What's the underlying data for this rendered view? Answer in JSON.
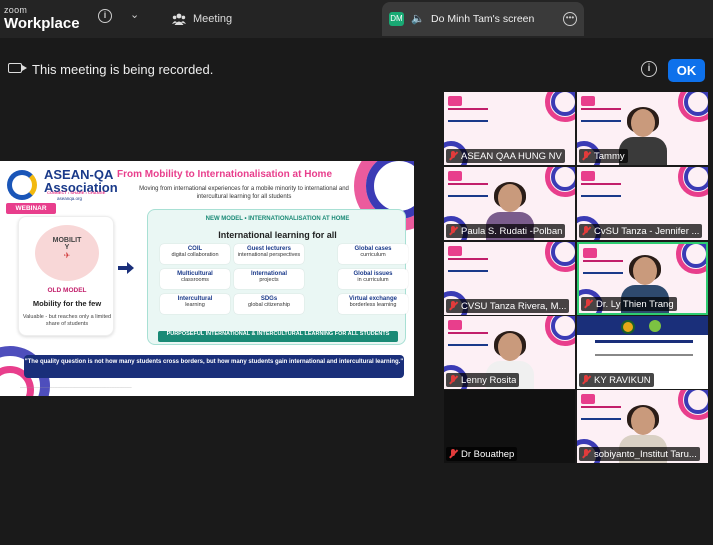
{
  "app": {
    "brand_top": "zoom",
    "brand_bottom": "Workplace"
  },
  "topbar": {
    "meeting_label": "Meeting",
    "share_badge": "DM",
    "share_label": "Do Minh Tam's screen"
  },
  "recording": {
    "message": "This meeting is being recorded.",
    "ok_label": "OK"
  },
  "slide": {
    "logo_title": "ASEAN-QA\nAssociation",
    "logo_tag": "CONNECT • SHARE • CHANGE",
    "logo_url": "aseanqa.org",
    "webinar_label": "WEBINAR",
    "title": "From Mobility to Internationalisation at Home",
    "subtitle": "Moving from international experiences for a mobile minority to international and intercultural learning for all students",
    "old_model": {
      "circle_line1": "MOBILIT",
      "circle_line2": "Y",
      "label": "OLD MODEL",
      "title": "Mobility for the few",
      "description": "Valuable - but reaches only a limited share of students"
    },
    "new_model": {
      "label": "NEW MODEL  •  INTERNATIONALISATION AT HOME",
      "title": "International learning for all",
      "cells": [
        {
          "heading": "COIL",
          "detail": "digital collaboration"
        },
        {
          "heading": "Guest lecturers",
          "detail": "international perspectives"
        },
        {
          "heading": "Global cases",
          "detail": "curriculum"
        },
        {
          "heading": "Multicultural",
          "detail": "classrooms"
        },
        {
          "heading": "International",
          "detail": "projects"
        },
        {
          "heading": "Global issues",
          "detail": "in curriculum"
        },
        {
          "heading": "Intercultural",
          "detail": "learning"
        },
        {
          "heading": "SDGs",
          "detail": "global citizenship"
        },
        {
          "heading": "Virtual exchange",
          "detail": "borderless learning"
        }
      ],
      "footer": "PURPOSEFUL INTERNATIONAL & INTERCULTURAL LEARNING FOR ALL STUDENTS"
    },
    "quote": "\"The quality question is not how many students cross borders, but how many students gain international and intercultural learning.\""
  },
  "participants": [
    {
      "name": "ASEAN QAA HUNG NV",
      "kind": "slide"
    },
    {
      "name": "Tammy",
      "kind": "person"
    },
    {
      "name": "Paula S. Rudati -Polban",
      "kind": "person"
    },
    {
      "name": "CvSU Tanza - Jennifer ...",
      "kind": "slide"
    },
    {
      "name": "CVSU Tanza Rivera, M...",
      "kind": "slide"
    },
    {
      "name": "Dr. Ly Thien Trang",
      "kind": "person",
      "active_speaker": true
    },
    {
      "name": "Lenny Rosita",
      "kind": "person"
    },
    {
      "name": "KY RAVIKUN",
      "kind": "banner"
    },
    {
      "name": "Dr Bouathep",
      "kind": "empty"
    },
    {
      "name": "sobiyanto_Institut Taru...",
      "kind": "person"
    }
  ],
  "colors": {
    "accent": "#0e71eb",
    "muted": "#e23b3b",
    "active_speaker": "#2ecc71",
    "slide_pink": "#e83e8c",
    "slide_navy": "#1a2f7a"
  }
}
